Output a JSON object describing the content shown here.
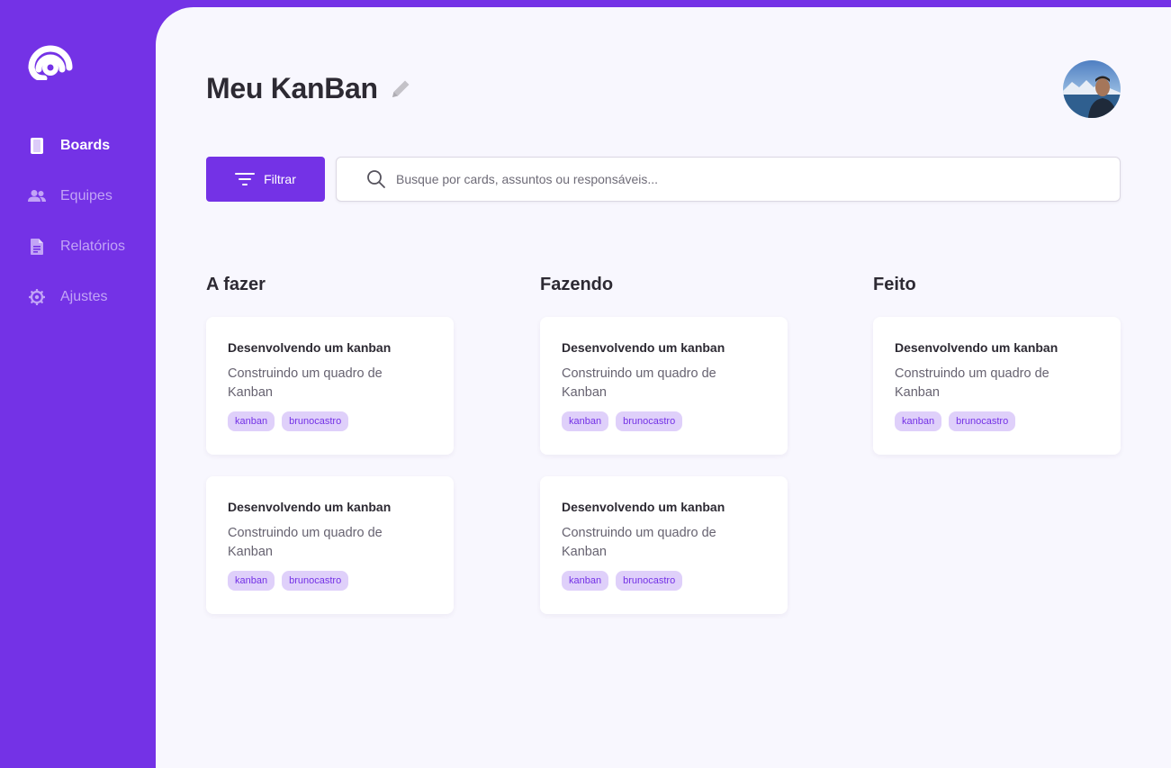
{
  "sidebar": {
    "items": [
      {
        "label": "Boards",
        "icon": "board-icon",
        "active": true
      },
      {
        "label": "Equipes",
        "icon": "users-icon",
        "active": false
      },
      {
        "label": "Relatórios",
        "icon": "document-icon",
        "active": false
      },
      {
        "label": "Ajustes",
        "icon": "gear-icon",
        "active": false
      }
    ]
  },
  "header": {
    "title": "Meu KanBan"
  },
  "toolbar": {
    "filter_label": "Filtrar",
    "search_placeholder": "Busque por cards, assuntos ou responsáveis..."
  },
  "columns": [
    {
      "title": "A fazer",
      "cards": [
        {
          "title": "Desenvolvendo um kanban",
          "description": "Construindo um quadro de Kanban",
          "tags": [
            "kanban",
            "brunocastro"
          ]
        },
        {
          "title": "Desenvolvendo um kanban",
          "description": "Construindo um quadro de Kanban",
          "tags": [
            "kanban",
            "brunocastro"
          ]
        }
      ]
    },
    {
      "title": "Fazendo",
      "cards": [
        {
          "title": "Desenvolvendo um kanban",
          "description": "Construindo um quadro de Kanban",
          "tags": [
            "kanban",
            "brunocastro"
          ]
        },
        {
          "title": "Desenvolvendo um kanban",
          "description": "Construindo um quadro de Kanban",
          "tags": [
            "kanban",
            "brunocastro"
          ]
        }
      ]
    },
    {
      "title": "Feito",
      "cards": [
        {
          "title": "Desenvolvendo um kanban",
          "description": "Construindo um quadro de Kanban",
          "tags": [
            "kanban",
            "brunocastro"
          ]
        }
      ]
    }
  ],
  "colors": {
    "brand": "#7432e6",
    "background": "#f8f7fe",
    "tag_bg": "#dfd0fa"
  }
}
